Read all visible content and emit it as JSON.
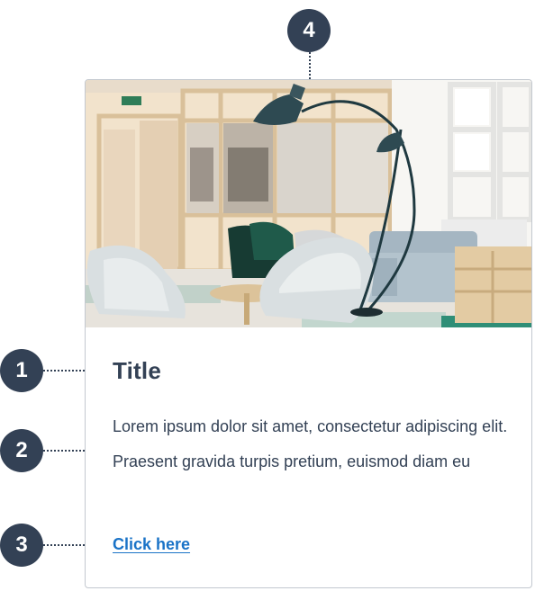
{
  "callouts": [
    {
      "number": "1",
      "target": "title"
    },
    {
      "number": "2",
      "target": "body"
    },
    {
      "number": "3",
      "target": "link"
    },
    {
      "number": "4",
      "target": "image"
    }
  ],
  "card": {
    "title": "Title",
    "body": "Lorem ipsum dolor sit amet, consectetur adipiscing elit. Praesent gravida turpis pretium, euismod diam eu",
    "link_label": "Click here",
    "image_icon": "office-lounge-photo"
  },
  "colors": {
    "badge": "#334155",
    "text": "#334155",
    "link": "#1a73c7",
    "border": "#c3c8cf"
  }
}
